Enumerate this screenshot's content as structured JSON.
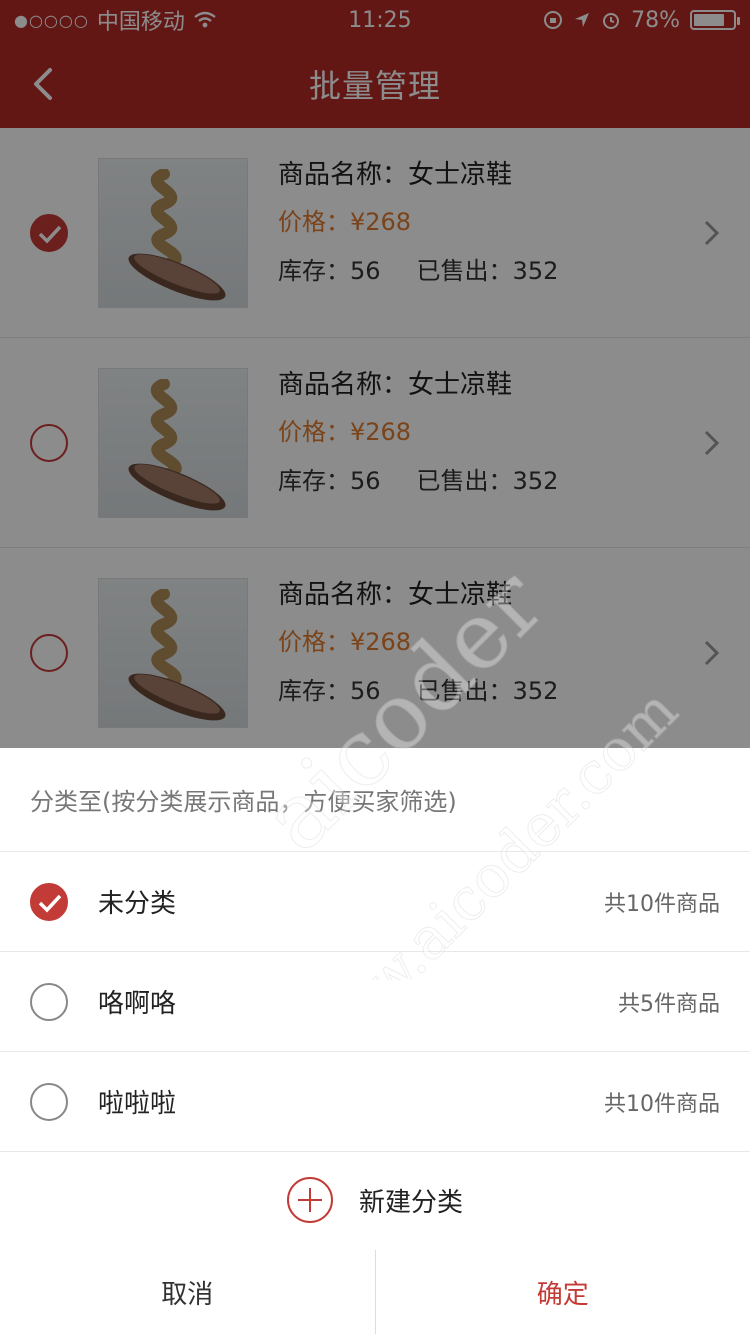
{
  "status_bar": {
    "carrier": "中国移动",
    "time": "11:25",
    "battery": "78%",
    "battery_level": 0.78
  },
  "nav": {
    "title": "批量管理"
  },
  "products": [
    {
      "name": "商品名称：女士凉鞋",
      "price": "价格：¥268",
      "stock": "库存：56",
      "sold": "已售出：352",
      "checked": true
    },
    {
      "name": "商品名称：女士凉鞋",
      "price": "价格：¥268",
      "stock": "库存：56",
      "sold": "已售出：352",
      "checked": false
    },
    {
      "name": "商品名称：女士凉鞋",
      "price": "价格：¥268",
      "stock": "库存：56",
      "sold": "已售出：352",
      "checked": false
    }
  ],
  "sheet": {
    "heading": "分类至(按分类展示商品，方便买家筛选)",
    "categories": [
      {
        "name": "未分类",
        "count": "共10件商品",
        "checked": true
      },
      {
        "name": "咯啊咯",
        "count": "共5件商品",
        "checked": false
      },
      {
        "name": "啦啦啦",
        "count": "共10件商品",
        "checked": false
      }
    ],
    "new_category_label": "新建分类",
    "cancel_label": "取消",
    "confirm_label": "确定"
  },
  "watermark": {
    "line1": "aicoder",
    "line2": "www.aicoder.com"
  },
  "colors": {
    "brand_red": "#b52b27",
    "check_red": "#c33b37",
    "price_orange": "#e07a2e"
  }
}
